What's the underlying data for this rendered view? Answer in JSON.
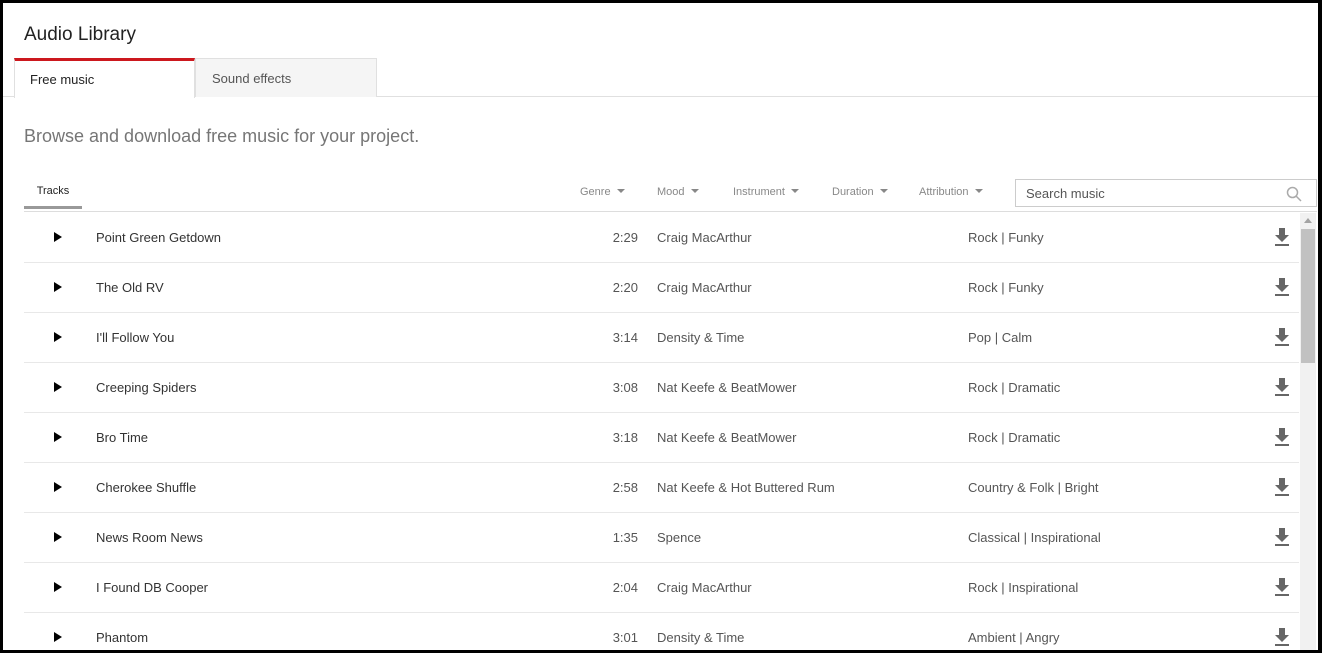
{
  "header": {
    "title": "Audio Library"
  },
  "tabs": [
    {
      "label": "Free music",
      "active": true
    },
    {
      "label": "Sound effects",
      "active": false
    }
  ],
  "subtitle": "Browse and download free music for your project.",
  "subtabs": {
    "tracks": "Tracks"
  },
  "filters": {
    "genre": "Genre",
    "mood": "Mood",
    "instrument": "Instrument",
    "duration": "Duration",
    "attribution": "Attribution"
  },
  "search": {
    "placeholder": "Search music"
  },
  "tracks": [
    {
      "name": "Point Green Getdown",
      "duration": "2:29",
      "artist": "Craig MacArthur",
      "genre": "Rock | Funky"
    },
    {
      "name": "The Old RV",
      "duration": "2:20",
      "artist": "Craig MacArthur",
      "genre": "Rock | Funky"
    },
    {
      "name": "I'll Follow You",
      "duration": "3:14",
      "artist": "Density & Time",
      "genre": "Pop | Calm"
    },
    {
      "name": "Creeping Spiders",
      "duration": "3:08",
      "artist": "Nat Keefe & BeatMower",
      "genre": "Rock | Dramatic"
    },
    {
      "name": "Bro Time",
      "duration": "3:18",
      "artist": "Nat Keefe & BeatMower",
      "genre": "Rock | Dramatic"
    },
    {
      "name": "Cherokee Shuffle",
      "duration": "2:58",
      "artist": "Nat Keefe & Hot Buttered Rum",
      "genre": "Country & Folk | Bright"
    },
    {
      "name": "News Room News",
      "duration": "1:35",
      "artist": "Spence",
      "genre": "Classical | Inspirational"
    },
    {
      "name": "I Found DB Cooper",
      "duration": "2:04",
      "artist": "Craig MacArthur",
      "genre": "Rock | Inspirational"
    },
    {
      "name": "Phantom",
      "duration": "3:01",
      "artist": "Density & Time",
      "genre": "Ambient | Angry"
    }
  ],
  "colors": {
    "accent": "#cc181e"
  }
}
